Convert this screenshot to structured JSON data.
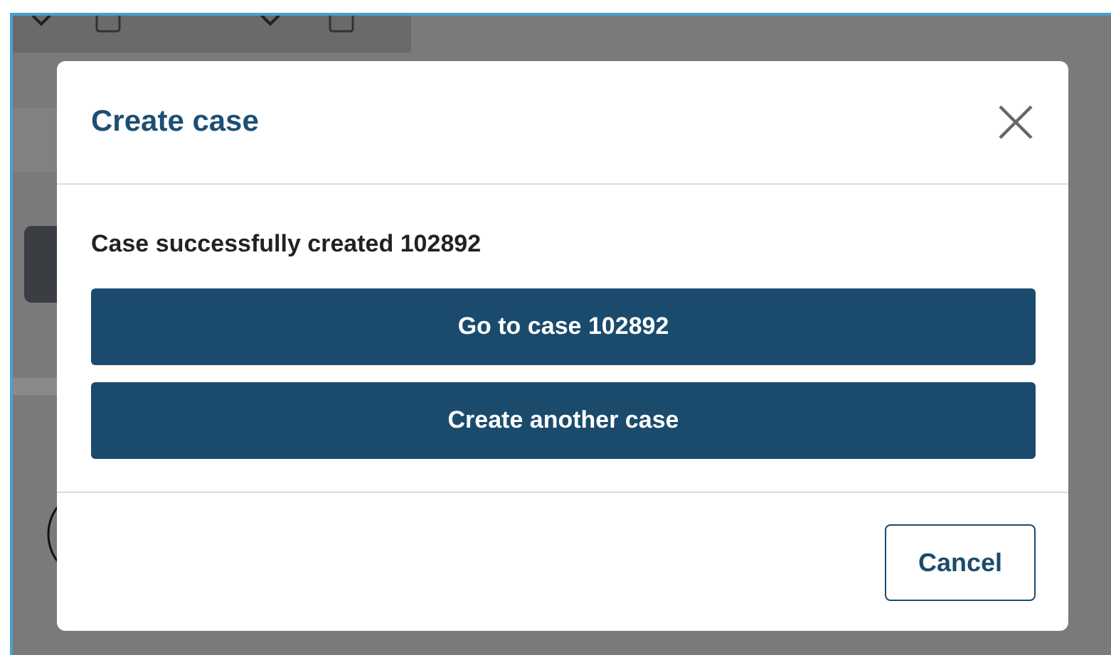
{
  "modal": {
    "title": "Create case",
    "message": "Case successfully created 102892",
    "actions": [
      {
        "label": "Go to case 102892"
      },
      {
        "label": "Create another case"
      }
    ],
    "footer_buttons": [
      {
        "label": "Cancel"
      }
    ]
  }
}
